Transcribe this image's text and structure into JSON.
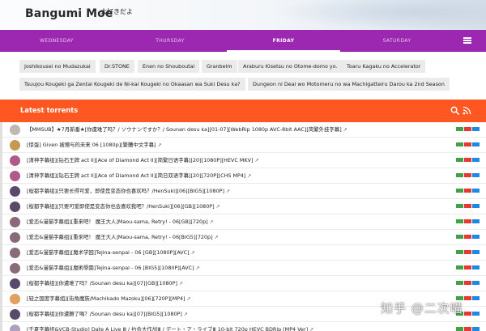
{
  "header": {
    "brand": "Bangumi Moe",
    "brand_sub": "大好きだよ"
  },
  "days": [
    {
      "label": "WEDNESDAY",
      "active": false
    },
    {
      "label": "THURSDAY",
      "active": false
    },
    {
      "label": "FRIDAY",
      "active": true
    },
    {
      "label": "SATURDAY",
      "active": false
    }
  ],
  "bangumi": [
    "Joshikousei no Mudazukai",
    "Dr.STONE",
    "Enen no Shouboutai",
    "Granbelm",
    "Araburu Kisetsu no Otome-domo yo.",
    "Toaru Kagaku no Accelerator",
    "Tsuujou Kougeki ga Zentai Kougeki de Ni-kai Kougeki no Okaasan wa Suki Desu ka?",
    "Dungeon ni Deai wo Motomeru no wa Machigatteiru Darou ka 2nd Season"
  ],
  "torrents_header": {
    "title": "Latest torrents",
    "search_icon": "search-icon",
    "rss_icon": "rss-icon"
  },
  "torrents": [
    {
      "title": "【MMSUB】★7月新番★[你遭难了吗？/ ソウナンですか？/ Sounan desu ka][01-07][WebRip 1080p AVC-8bit AAC][简繁外挂字幕]",
      "avatar": "#c0b8b0"
    },
    {
      "title": "[惊蛋] Given 被赠与的未来 06 [1080p][繁體中文字幕]",
      "avatar": "#c49a52"
    },
    {
      "title": "[清神字幕组][钻石王牌 act II][Ace of Diamond Act II][简繁日语字幕][20][1080P][HEVC MKV]",
      "avatar": "#b05a8a"
    },
    {
      "title": "[清神字幕组][钻石王牌 act II][Ace of Diamond Act II][简日双语字幕][20][720P][CHS MP4]",
      "avatar": "#b05a8a"
    },
    {
      "title": "[桜都字幕组][只要长得可爱，即使是变态你也喜欢吗？/HenSuki][06][BIG5][1080P]",
      "avatar": "#5a4a6a"
    },
    {
      "title": "[桜都字幕组][只要可爱即使是变态你也会喜欢我吧？/HenSuki][06][GB][1080P]",
      "avatar": "#5a4a6a"
    },
    {
      "title": "[爱恋&漫猫字幕组][重来吧！ 魔王大人]Maou-sama, Retry! - 06[GB][720p]",
      "avatar": "#8a6a7a"
    },
    {
      "title": "[爱恋&漫猫字幕组][重來吧！ 魔王大人]Maou-sama, Retry! - 06[BIG5][720p]",
      "avatar": "#8a6a7a"
    },
    {
      "title": "[爱恋&漫猫字幕组][魔术学园]Tejina-senpai - 06 [GB][1080P][AVC]",
      "avatar": "#8a6a7a"
    },
    {
      "title": "[爱恋&漫猫字幕组][魔術學園]Tejina-senpai - 06 [BIG5][1080P][AVC]",
      "avatar": "#8a6a7a"
    },
    {
      "title": "[桜都字幕组][你遭难了吗？/Sounan desu ka][07][GB][1080P]",
      "avatar": "#5a4a6a"
    },
    {
      "title": "[轻之国度字幕组][街角魔族/Machikado Mazoku][06][720P][MP4]",
      "avatar": "#e0a060"
    },
    {
      "title": "[桜都字幕组][你遭難了嗎？/Sounan desu ka][07][BIG5][1080P]",
      "avatar": "#5a4a6a"
    },
    {
      "title": "[千夏字幕组&VCB-Studio] Date A Live Ⅲ / 约会大作战Ⅲ / デート・ア・ライブⅢ 10-bit 720p HEVC BDRip [MP4 Ver]",
      "avatar": "#b0a0c0"
    }
  ],
  "watermark": "知乎 @二次喵"
}
